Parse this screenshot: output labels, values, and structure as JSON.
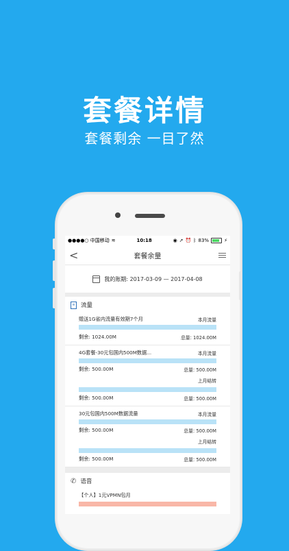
{
  "hero": {
    "title": "套餐详情",
    "subtitle": "套餐剩余 一目了然"
  },
  "status": {
    "carrier": "●●●●○ 中国移动",
    "time": "10:18",
    "battery": "83%",
    "icons": [
      "wifi-icon",
      "location-icon",
      "alarm-icon",
      "bluetooth-icon"
    ]
  },
  "nav": {
    "title": "套餐余量",
    "back_icon": "back-chevron-icon",
    "menu_icon": "menu-icon"
  },
  "period": {
    "label": "我的账期: 2017-03-09 — 2017-04-08"
  },
  "flow": {
    "title": "流量",
    "items": [
      {
        "name": "赠送1G省内流量有效期7个月",
        "tag": "本月流量",
        "remaining": "剩余: 1024.00M",
        "total": "总量: 1024.00M"
      },
      {
        "name": "4G套餐-30元包国内500M数据...",
        "tag": "本月流量",
        "remaining": "剩余: 500.00M",
        "total": "总量: 500.00M",
        "carry_tag": "上月结转",
        "carry_remaining": "剩余: 500.00M",
        "carry_total": "总量: 500.00M"
      },
      {
        "name": "30元包国内500M数据流量",
        "tag": "本月流量",
        "remaining": "剩余: 500.00M",
        "total": "总量: 500.00M",
        "carry_tag": "上月结转",
        "carry_remaining": "剩余: 500.00M",
        "carry_total": "总量: 500.00M"
      }
    ]
  },
  "voice": {
    "title": "语音",
    "items": [
      {
        "name": "【个人】1元VPMN包月"
      }
    ]
  }
}
